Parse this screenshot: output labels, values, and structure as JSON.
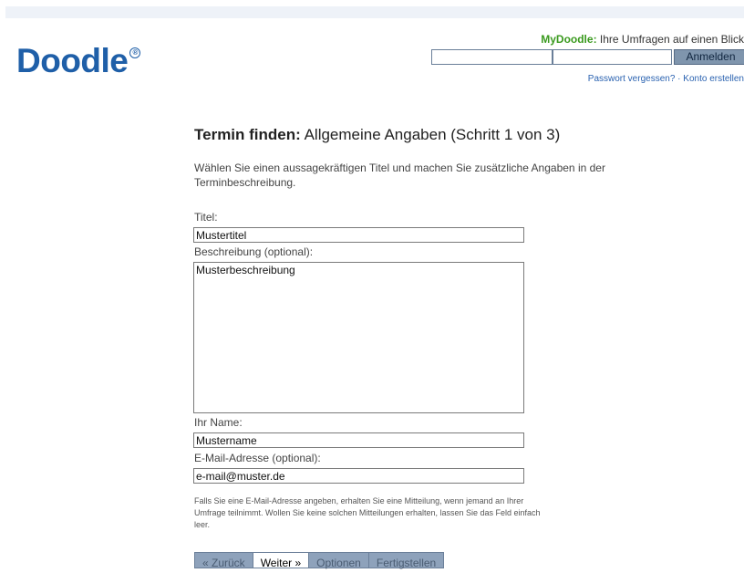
{
  "header": {
    "logo_text": "Doodle",
    "logo_reg": "®",
    "mydoodle_brand": "MyDoodle:",
    "mydoodle_text": " Ihre Umfragen auf einen Blick",
    "login_button": "Anmelden",
    "forgot_password": "Passwort vergessen?",
    "link_separator": " · ",
    "create_account": "Konto erstellen"
  },
  "page": {
    "heading_bold": "Termin finden:",
    "heading_rest": " Allgemeine Angaben (Schritt 1 von 3)",
    "intro": "Wählen Sie einen aussagekräftigen Titel und machen Sie zusätzliche Angaben in der Terminbeschreibung."
  },
  "form": {
    "title_label": "Titel:",
    "title_value": "Mustertitel",
    "description_label": "Beschreibung (optional):",
    "description_value": "Musterbeschreibung",
    "name_label": "Ihr Name:",
    "name_value": "Mustername",
    "email_label": "E-Mail-Adresse (optional):",
    "email_value": "e-mail@muster.de",
    "note": "Falls Sie eine E-Mail-Adresse angeben, erhalten Sie eine Mitteilung, wenn jemand an Ihrer Umfrage teilnimmt. Wollen Sie keine solchen Mitteilungen erhalten, lassen Sie das Feld einfach leer."
  },
  "wizard": {
    "back": "« Zurück",
    "next": "Weiter »",
    "options": "Optionen",
    "finish": "Fertigstellen"
  },
  "colors": {
    "logo": "#1f5fa8",
    "brand_green": "#3a9a1e",
    "link": "#2a62b0",
    "button_bg": "#8ea2bb"
  }
}
